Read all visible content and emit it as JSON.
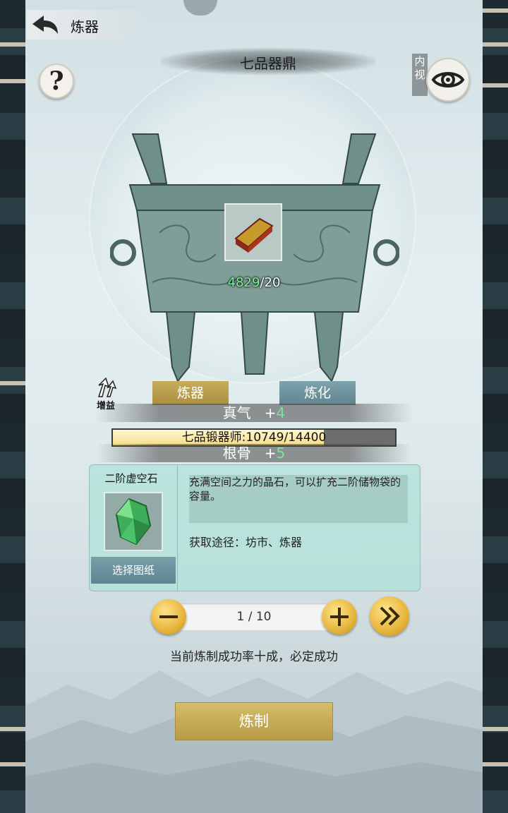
{
  "header": {
    "title": "炼器"
  },
  "cauldron": {
    "name": "七品器鼎",
    "material_have": "4829",
    "material_need": "/20"
  },
  "inner_view_label": "内视",
  "buff_label": "增益",
  "tabs": [
    {
      "label": "炼器",
      "active": true
    },
    {
      "label": "炼化",
      "active": false
    }
  ],
  "stats": [
    {
      "name": "真气",
      "plus": "+",
      "value": "4"
    },
    {
      "name": "根骨",
      "plus": "+",
      "value": "5"
    }
  ],
  "progress": {
    "label": "七品锻器师:10749/14400",
    "fraction": 0.7465
  },
  "item": {
    "name": "二阶虚空石",
    "description": "充满空间之力的晶石，可以扩充二阶储物袋的容量。",
    "source": "获取途径：坊市、炼器",
    "select_label": "选择图纸"
  },
  "quantity": {
    "text": "1 / 10"
  },
  "hint": "当前炼制成功率十成，必定成功",
  "forge_button": "炼制",
  "colors": {
    "gold": "#c6ac5c",
    "teal_tab": "#7fa2ac",
    "green_value": "#7fe39a",
    "panel": "#b0e1d8"
  }
}
